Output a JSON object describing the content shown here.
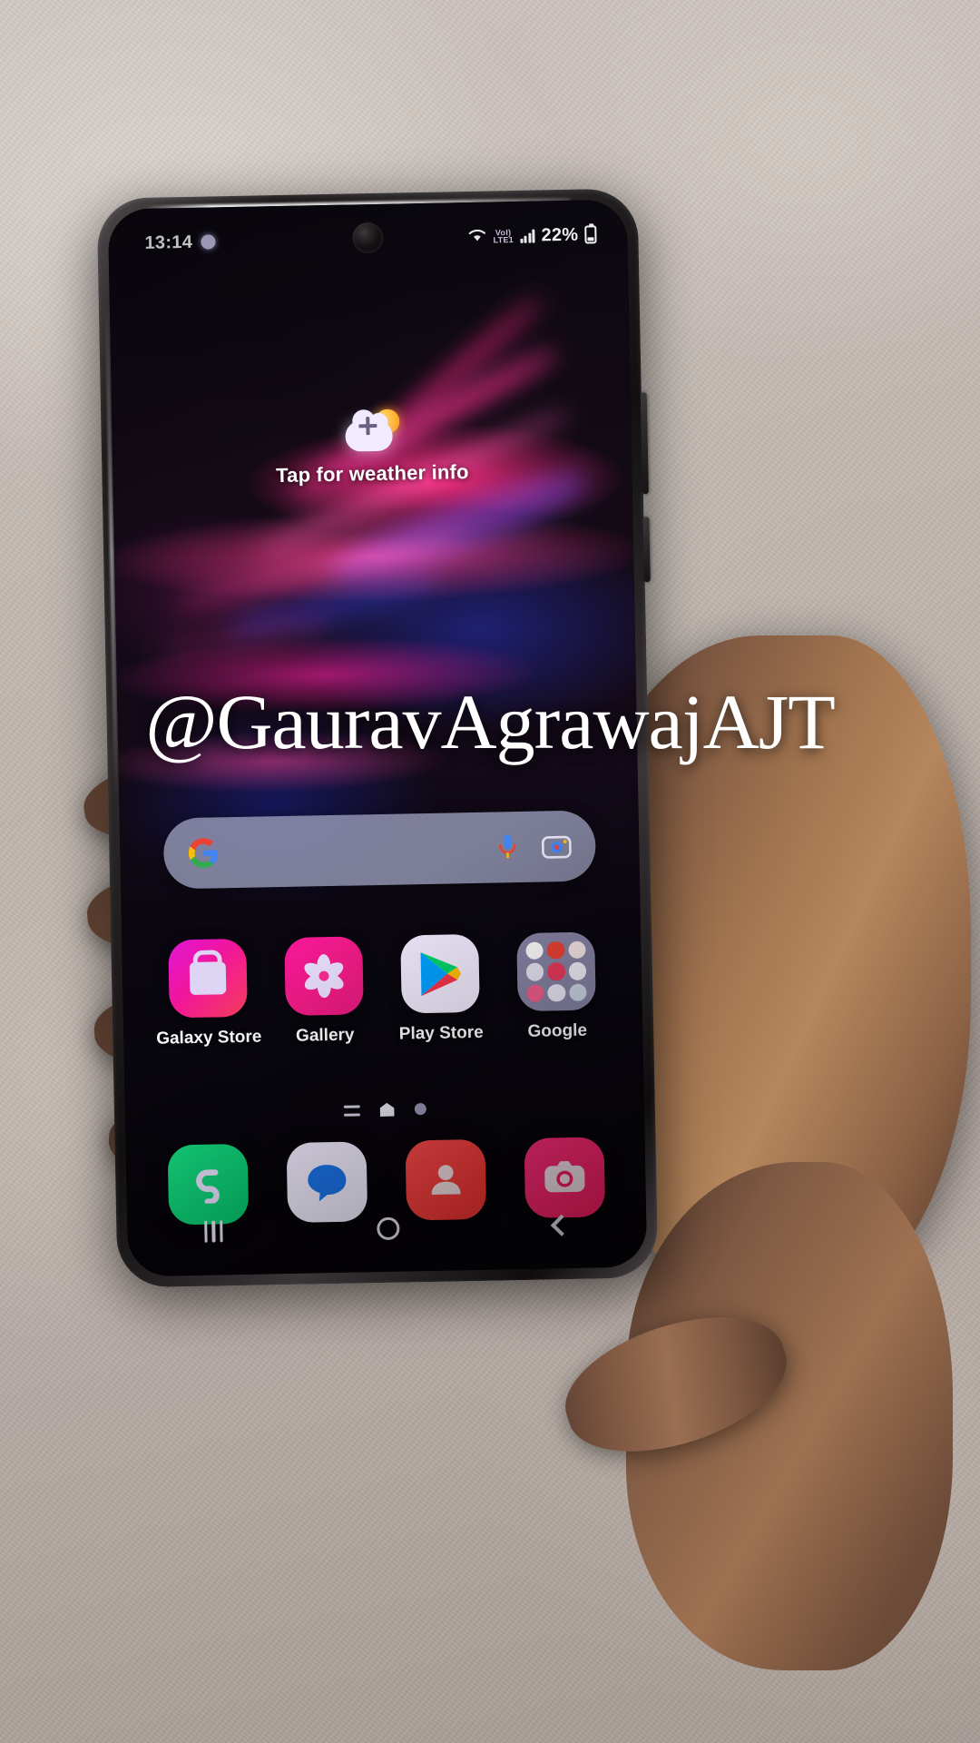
{
  "status_bar": {
    "time": "13:14",
    "dnd_icon": "dnd-dot-icon",
    "wifi_icon": "wifi-icon",
    "volte_top": "VoI)",
    "volte_bottom": "LTE1",
    "signal_icon": "signal-bars-icon",
    "battery_percent": "22%",
    "battery_icon": "battery-icon",
    "battery_level": 22
  },
  "weather_widget": {
    "label": "Tap for weather info",
    "icon": "weather-add-icon"
  },
  "search": {
    "logo": "google-g-icon",
    "mic_icon": "microphone-icon",
    "lens_icon": "google-lens-icon",
    "placeholder": ""
  },
  "apps": [
    {
      "label": "Galaxy Store",
      "icon": "galaxy-store-icon",
      "color": "#f0159a"
    },
    {
      "label": "Gallery",
      "icon": "gallery-icon",
      "color": "#ef1b86"
    },
    {
      "label": "Play Store",
      "icon": "play-store-icon",
      "color": "#efe8fb"
    },
    {
      "label": "Google",
      "icon": "google-folder-icon",
      "color": "#9896ba"
    }
  ],
  "page_indicator": {
    "list_icon": "app-list-icon",
    "home_icon": "home-page-icon",
    "dot_icon": "page-dot-icon",
    "current_page": 1,
    "total_pages": 2
  },
  "dock": [
    {
      "label": "Phone",
      "icon": "phone-icon",
      "color": "#05c46b"
    },
    {
      "label": "Messages",
      "icon": "messages-icon",
      "color": "#2979ff"
    },
    {
      "label": "Contacts",
      "icon": "contacts-icon",
      "color": "#f0322f"
    },
    {
      "label": "Camera",
      "icon": "camera-icon",
      "color": "#fa1e63"
    }
  ],
  "nav_bar": {
    "recents_icon": "recents-icon",
    "home_icon": "home-icon",
    "back_icon": "back-icon"
  },
  "overlay": {
    "watermark": "@GauravAgrawajAJT"
  },
  "theme": {
    "accent_pink": "#f0159a",
    "accent_blue": "#2979ff",
    "screen_bg": "#0b0810",
    "search_bar_bg": "#9698b6"
  }
}
